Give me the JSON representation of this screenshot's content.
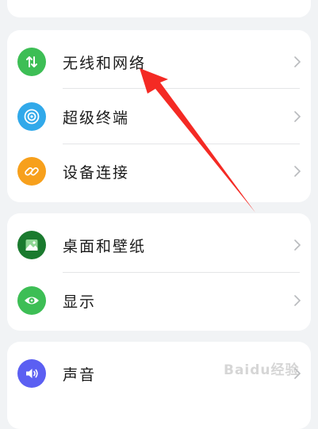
{
  "colors": {
    "page_background": "#f1f3f5",
    "card_background": "#ffffff",
    "arrow": "#f42a24"
  },
  "settings": {
    "group1": [
      {
        "label": "无线和网络",
        "icon": "network-arrows-icon",
        "icon_color": "#3dbe55"
      },
      {
        "label": "超级终端",
        "icon": "super-device-icon",
        "icon_color": "#31a9ea"
      },
      {
        "label": "设备连接",
        "icon": "link-icon",
        "icon_color": "#f7a01c"
      }
    ],
    "group2": [
      {
        "label": "桌面和壁纸",
        "icon": "wallpaper-icon",
        "icon_color": "#1a7a2e"
      },
      {
        "label": "显示",
        "icon": "eye-icon",
        "icon_color": "#3dbe55"
      }
    ],
    "group3": [
      {
        "label": "声音",
        "icon": "speaker-icon",
        "icon_color": "#5b5ff2"
      }
    ]
  },
  "watermark": "Baidu经验"
}
